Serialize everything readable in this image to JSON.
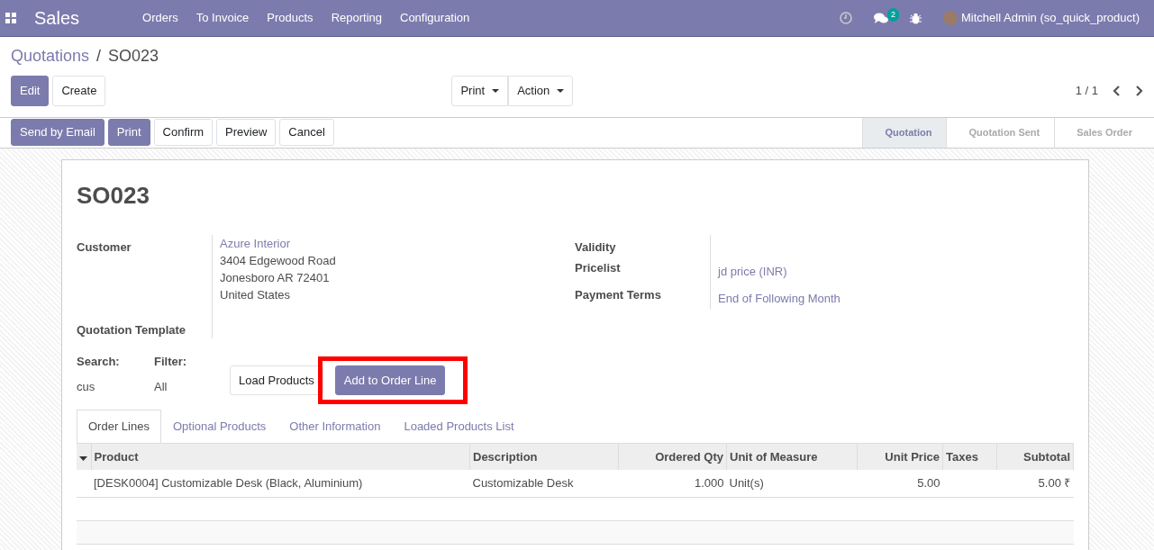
{
  "navbar": {
    "app": "Sales",
    "menu": [
      "Orders",
      "To Invoice",
      "Products",
      "Reporting",
      "Configuration"
    ],
    "message_count": "2",
    "user": "Mitchell Admin (so_quick_product)"
  },
  "breadcrumb": {
    "parent": "Quotations",
    "separator": "/",
    "current": "SO023"
  },
  "main_buttons": [
    {
      "label": "Edit",
      "primary": true
    },
    {
      "label": "Create",
      "primary": false
    }
  ],
  "dropdowns": [
    "Print",
    "Action"
  ],
  "pager": "1 / 1",
  "header_buttons": [
    {
      "label": "Send by Email",
      "primary": true
    },
    {
      "label": "Print",
      "primary": true
    },
    {
      "label": "Confirm",
      "primary": false
    },
    {
      "label": "Preview",
      "primary": false
    },
    {
      "label": "Cancel",
      "primary": false
    }
  ],
  "stages": [
    {
      "label": "Quotation",
      "selected": true
    },
    {
      "label": "Quotation Sent",
      "selected": false
    },
    {
      "label": "Sales Order",
      "selected": false
    }
  ],
  "title": "SO023",
  "left_fields": [
    {
      "label": "Customer",
      "lines": [
        {
          "text": "Azure Interior",
          "link": true
        },
        {
          "text": "3404 Edgewood Road",
          "link": false
        },
        {
          "text": "Jonesboro AR 72401",
          "link": false
        },
        {
          "text": "United States",
          "link": false
        }
      ]
    },
    {
      "label": "Quotation Template"
    }
  ],
  "right_fields": [
    {
      "label": "Validity"
    },
    {
      "label": "Pricelist",
      "value": "jd price (INR)"
    },
    {
      "label": "Payment Terms",
      "value": "End of Following Month"
    }
  ],
  "search": {
    "label": "Search:",
    "value": "cus"
  },
  "filter": {
    "label": "Filter:",
    "value": "All"
  },
  "load_buttons": [
    {
      "label": "Load Products",
      "primary": false,
      "highlighted": false
    },
    {
      "label": "Add to Order Line",
      "primary": true,
      "highlighted": true
    }
  ],
  "tabs": [
    {
      "label": "Order Lines",
      "selected": true
    },
    {
      "label": "Optional Products",
      "selected": false
    },
    {
      "label": "Other Information",
      "selected": false
    },
    {
      "label": "Loaded Products List",
      "selected": false
    }
  ],
  "table": {
    "columns": [
      "Product",
      "Description",
      "Ordered Qty",
      "Unit of Measure",
      "Unit Price",
      "Taxes",
      "Subtotal"
    ],
    "rows": [
      [
        "[DESK0004] Customizable Desk (Black, Aluminium)",
        "Customizable Desk",
        "1.000",
        "Unit(s)",
        "5.00",
        "",
        "5.00 ₹"
      ]
    ]
  }
}
